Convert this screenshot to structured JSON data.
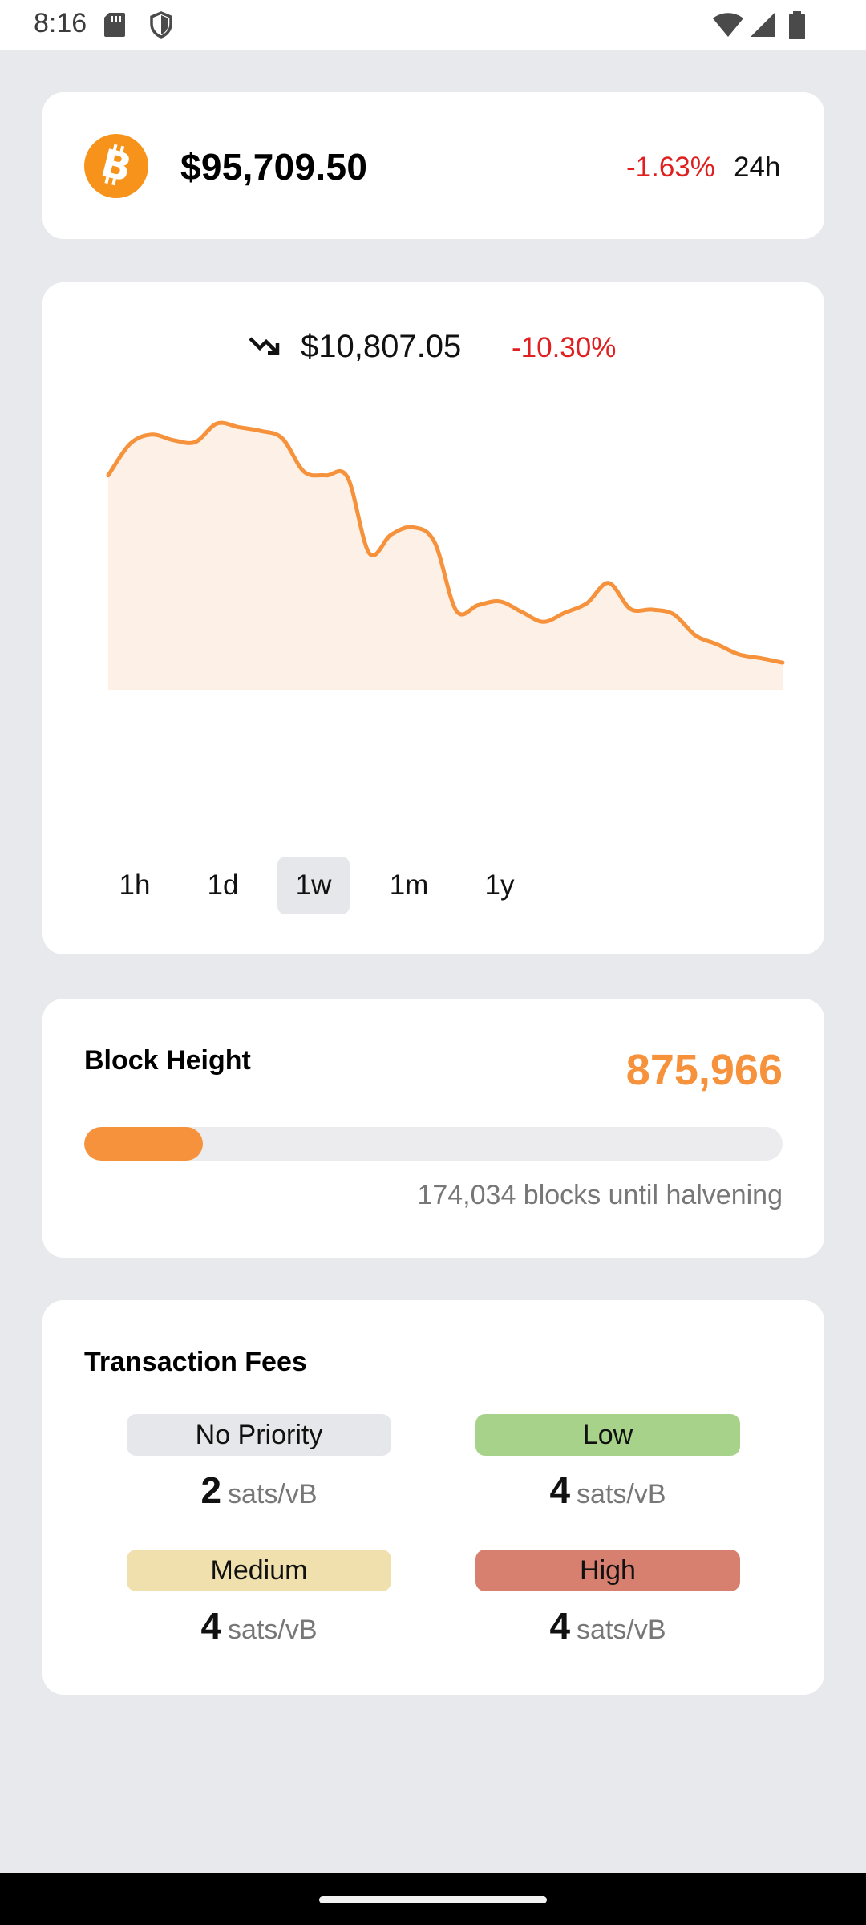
{
  "status_bar": {
    "time": "8:16"
  },
  "price": {
    "value": "$95,709.50",
    "change": "-1.63%",
    "period": "24h",
    "icon": "bitcoin-logo"
  },
  "chart": {
    "delta_value": "$10,807.05",
    "delta_percent": "-10.30%",
    "trend_icon": "trending-down-icon",
    "ranges": [
      "1h",
      "1d",
      "1w",
      "1m",
      "1y"
    ],
    "selected_range": "1w",
    "line_color": "#f7923c",
    "fill_color": "#fdf1e7"
  },
  "chart_data": {
    "type": "area",
    "title": "",
    "xlabel": "",
    "ylabel": "",
    "grid": false,
    "y": [
      106200,
      107050,
      107300,
      107150,
      107100,
      107600,
      107500,
      107400,
      107200,
      106300,
      106200,
      106150,
      104100,
      104600,
      104800,
      104400,
      102550,
      102700,
      102800,
      102520,
      102250,
      102500,
      102750,
      103300,
      102600,
      102580,
      102450,
      101880,
      101640,
      101370,
      101270,
      101150
    ]
  },
  "block_height": {
    "label": "Block Height",
    "value": "875,966",
    "progress": 0.17,
    "remaining_text": "174,034 blocks until halvening"
  },
  "fees": {
    "title": "Transaction Fees",
    "unit": "sats/vB",
    "items": [
      {
        "label": "No Priority",
        "value": "2",
        "color": "#e6e7ea"
      },
      {
        "label": "Low",
        "value": "4",
        "color": "#a6d28a"
      },
      {
        "label": "Medium",
        "value": "4",
        "color": "#f0e0ad"
      },
      {
        "label": "High",
        "value": "4",
        "color": "#d88070"
      }
    ]
  }
}
